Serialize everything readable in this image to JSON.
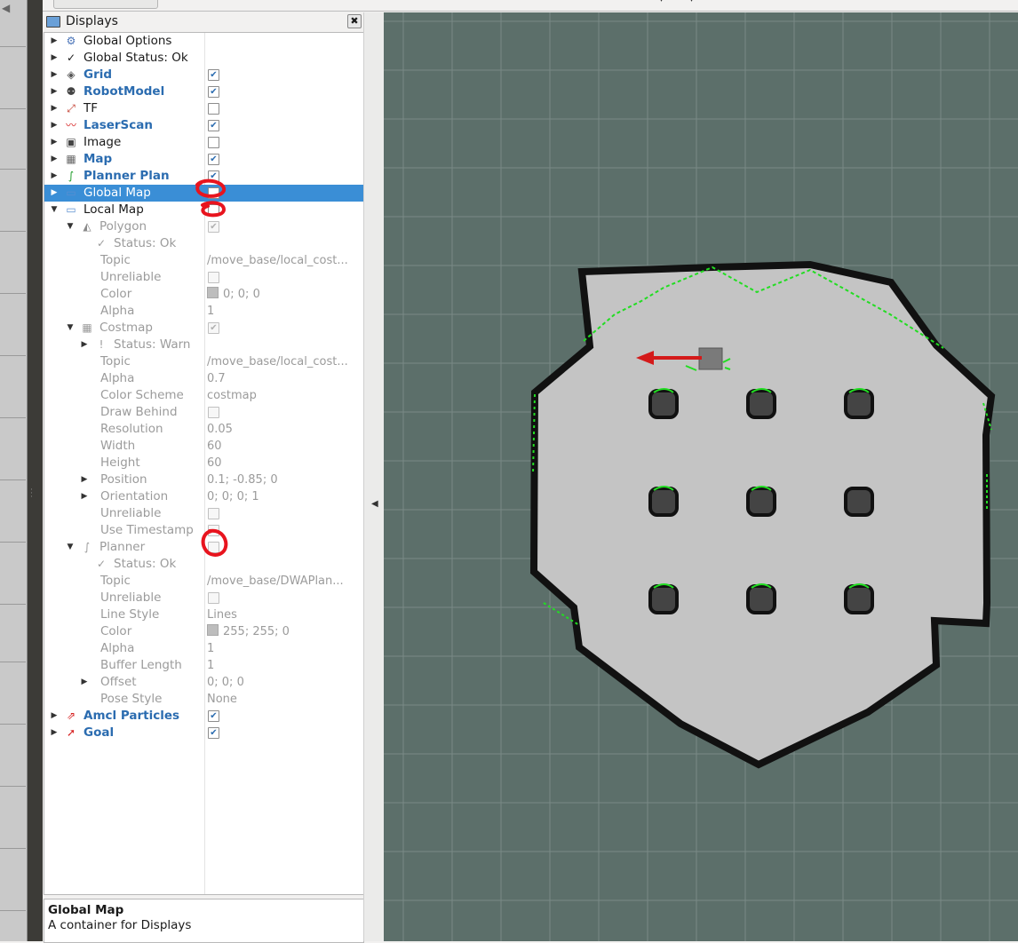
{
  "panel": {
    "title": "Displays",
    "close_label": "✖"
  },
  "tree": [
    {
      "label": "Global Options",
      "level": 0,
      "expander": "▶",
      "icon": "gear-icon",
      "glyph": "⚙",
      "icon_color": "#4a74b8",
      "style": "normal"
    },
    {
      "label": "Global Status: Ok",
      "level": 0,
      "expander": "▶",
      "icon": "checkmark-icon",
      "glyph": "✓",
      "icon_color": "#1a1a1a",
      "style": "normal"
    },
    {
      "label": "Grid",
      "level": 0,
      "expander": "▶",
      "icon": "grid-icon",
      "glyph": "◈",
      "icon_color": "#555555",
      "style": "bold",
      "checkbox": true,
      "checked": true
    },
    {
      "label": "RobotModel",
      "level": 0,
      "expander": "▶",
      "icon": "robot-icon",
      "glyph": "⚉",
      "icon_color": "#444444",
      "style": "bold",
      "checkbox": true,
      "checked": true
    },
    {
      "label": "TF",
      "level": 0,
      "expander": "▶",
      "icon": "axes-icon",
      "glyph": "⤢",
      "icon_color": "#c0392b",
      "style": "normal",
      "checkbox": true,
      "checked": false
    },
    {
      "label": "LaserScan",
      "level": 0,
      "expander": "▶",
      "icon": "laser-scan-icon",
      "glyph": "〰",
      "icon_color": "#d62020",
      "style": "bold",
      "checkbox": true,
      "checked": true
    },
    {
      "label": "Image",
      "level": 0,
      "expander": "▶",
      "icon": "image-icon",
      "glyph": "▣",
      "icon_color": "#444444",
      "style": "normal",
      "checkbox": true,
      "checked": false
    },
    {
      "label": "Map",
      "level": 0,
      "expander": "▶",
      "icon": "map-icon",
      "glyph": "▦",
      "icon_color": "#666666",
      "style": "bold",
      "checkbox": true,
      "checked": true
    },
    {
      "label": "Planner Plan",
      "level": 0,
      "expander": "▶",
      "icon": "path-icon",
      "glyph": "∫",
      "icon_color": "#1f9d2a",
      "style": "bold",
      "checkbox": true,
      "checked": true
    },
    {
      "label": "Global Map",
      "level": 0,
      "expander": "▶",
      "icon": "folder-icon",
      "glyph": "▭",
      "icon_color": "#5b8fd0",
      "style": "normal",
      "selected": true,
      "checkbox": true,
      "checked": false
    },
    {
      "label": "Local Map",
      "level": 0,
      "expander": "▼",
      "icon": "folder-icon",
      "glyph": "▭",
      "icon_color": "#5b8fd0",
      "style": "normal",
      "checkbox": true,
      "checked": false
    },
    {
      "label": "Polygon",
      "level": 1,
      "expander": "▼",
      "icon": "polygon-icon",
      "glyph": "◭",
      "icon_color": "#8a8a8a",
      "style": "dim",
      "checkbox": true,
      "checked": true
    },
    {
      "label": "Status: Ok",
      "level": 2,
      "icon": "checkmark-icon",
      "glyph": "✓",
      "icon_color": "#9b9b9b",
      "style": "dim"
    },
    {
      "label": "Topic",
      "level": 2,
      "style": "dim",
      "value": "/move_base/local_cost..."
    },
    {
      "label": "Unreliable",
      "level": 2,
      "style": "dim",
      "checkbox": true,
      "checked": false
    },
    {
      "label": "Color",
      "level": 2,
      "style": "dim",
      "value": "0; 0; 0",
      "swatch": "#bdbdbd"
    },
    {
      "label": "Alpha",
      "level": 2,
      "style": "dim",
      "value": "1"
    },
    {
      "label": "Costmap",
      "level": 1,
      "expander": "▼",
      "icon": "map-icon",
      "glyph": "▦",
      "icon_color": "#9b9b9b",
      "style": "dim",
      "checkbox": true,
      "checked": true
    },
    {
      "label": "Status: Warn",
      "level": 2,
      "expander": "▶",
      "icon": "warning-icon",
      "glyph": "!",
      "icon_color": "#9b9b9b",
      "style": "dim"
    },
    {
      "label": "Topic",
      "level": 2,
      "style": "dim",
      "value": "/move_base/local_cost..."
    },
    {
      "label": "Alpha",
      "level": 2,
      "style": "dim",
      "value": "0.7"
    },
    {
      "label": "Color Scheme",
      "level": 2,
      "style": "dim",
      "value": "costmap"
    },
    {
      "label": "Draw Behind",
      "level": 2,
      "style": "dim",
      "checkbox": true,
      "checked": false
    },
    {
      "label": "Resolution",
      "level": 2,
      "style": "dim",
      "value": "0.05"
    },
    {
      "label": "Width",
      "level": 2,
      "style": "dim",
      "value": "60"
    },
    {
      "label": "Height",
      "level": 2,
      "style": "dim",
      "value": "60"
    },
    {
      "label": "Position",
      "level": 2,
      "expander": "▶",
      "style": "dim",
      "value": "0.1; -0.85; 0"
    },
    {
      "label": "Orientation",
      "level": 2,
      "expander": "▶",
      "style": "dim",
      "value": "0; 0; 0; 1"
    },
    {
      "label": "Unreliable",
      "level": 2,
      "style": "dim",
      "checkbox": true,
      "checked": false
    },
    {
      "label": "Use Timestamp",
      "level": 2,
      "style": "dim",
      "checkbox": true,
      "checked": false
    },
    {
      "label": "Planner",
      "level": 1,
      "expander": "▼",
      "icon": "path-icon",
      "glyph": "∫",
      "icon_color": "#9b9b9b",
      "style": "dim",
      "checkbox": true,
      "checked": false
    },
    {
      "label": "Status: Ok",
      "level": 2,
      "icon": "checkmark-icon",
      "glyph": "✓",
      "icon_color": "#9b9b9b",
      "style": "dim"
    },
    {
      "label": "Topic",
      "level": 2,
      "style": "dim",
      "value": "/move_base/DWAPlan..."
    },
    {
      "label": "Unreliable",
      "level": 2,
      "style": "dim",
      "checkbox": true,
      "checked": false
    },
    {
      "label": "Line Style",
      "level": 2,
      "style": "dim",
      "value": "Lines"
    },
    {
      "label": "Color",
      "level": 2,
      "style": "dim",
      "value": "255; 255; 0",
      "swatch": "#bdbdbd"
    },
    {
      "label": "Alpha",
      "level": 2,
      "style": "dim",
      "value": "1"
    },
    {
      "label": "Buffer Length",
      "level": 2,
      "style": "dim",
      "value": "1"
    },
    {
      "label": "Offset",
      "level": 2,
      "expander": "▶",
      "style": "dim",
      "value": "0; 0; 0"
    },
    {
      "label": "Pose Style",
      "level": 2,
      "style": "dim",
      "value": "None"
    },
    {
      "label": "Amcl Particles",
      "level": 0,
      "expander": "▶",
      "icon": "particles-icon",
      "glyph": "⇗",
      "icon_color": "#d62020",
      "style": "bold",
      "checkbox": true,
      "checked": true
    },
    {
      "label": "Goal",
      "level": 0,
      "expander": "▶",
      "icon": "arrow-icon",
      "glyph": "➚",
      "icon_color": "#d62020",
      "style": "bold",
      "checkbox": true,
      "checked": true
    }
  ],
  "description": {
    "title": "Global Map",
    "text": "A container for Displays"
  },
  "colors": {
    "selection": "#3a8ed6",
    "viewport_bg": "#5c6f6a",
    "map_free": "#c4c4c4",
    "map_wall": "#111111",
    "laser": "#22dd22",
    "goal_arrow": "#d41a1a",
    "annotation_red": "#e8141e"
  }
}
